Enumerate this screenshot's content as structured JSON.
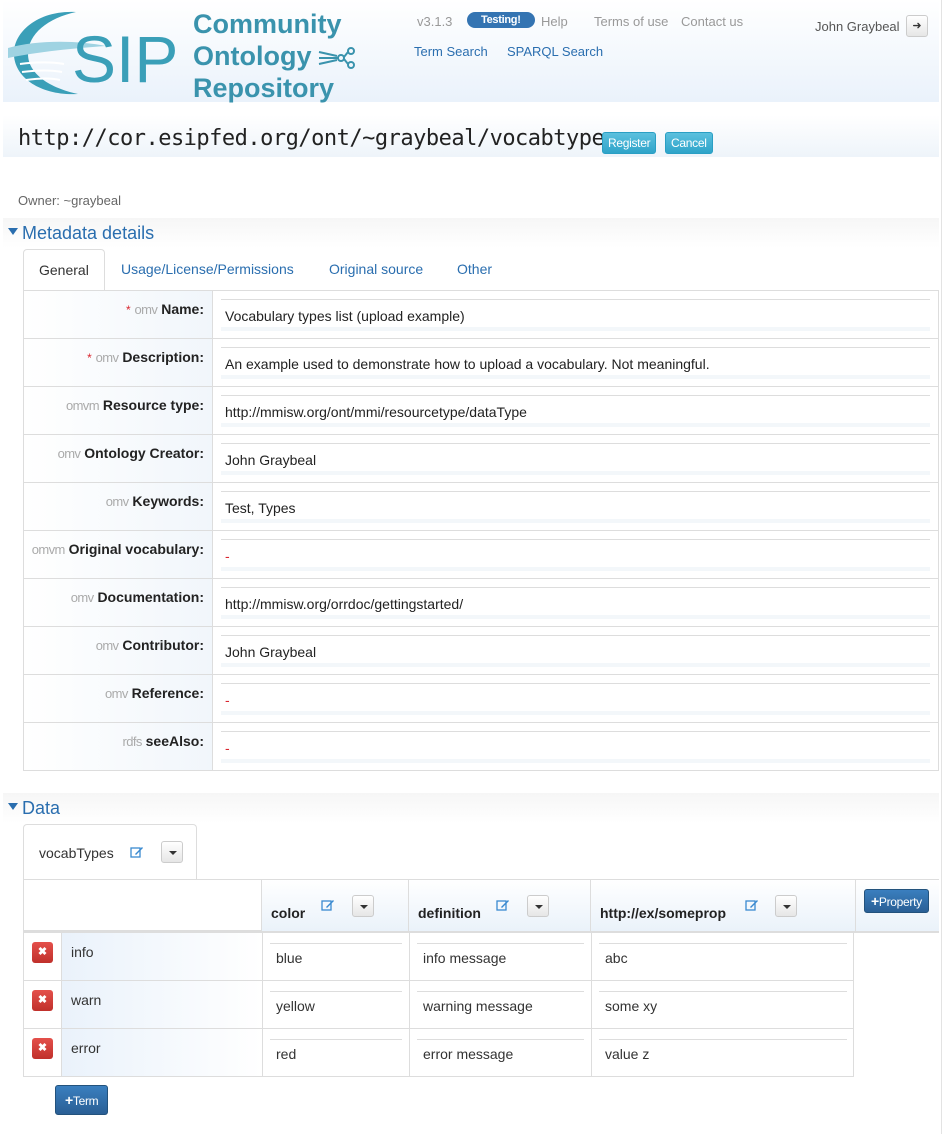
{
  "header": {
    "logo_letters": "SIP",
    "logo_lines": [
      "Community",
      "Ontology",
      "Repository"
    ],
    "version": "v3.1.3",
    "testing_badge": "Testing!",
    "help_link": "Help",
    "terms_link": "Terms of use",
    "contact_link": "Contact us",
    "term_search_link": "Term Search",
    "sparql_search_link": "SPARQL Search",
    "user_name": "John Graybeal",
    "logout_icon": "sign-out-icon"
  },
  "uri_bar": {
    "uri": "http://cor.esipfed.org/ont/~graybeal/vocabtypes",
    "register_label": "Register",
    "cancel_label": "Cancel"
  },
  "owner": "Owner: ~graybeal",
  "metadata": {
    "section_title": "Metadata details",
    "tabs": [
      {
        "label": "General",
        "active": true
      },
      {
        "label": "Usage/License/Permissions",
        "active": false
      },
      {
        "label": "Original source",
        "active": false
      },
      {
        "label": "Other",
        "active": false
      }
    ],
    "rows": [
      {
        "required": "*",
        "ns": "omv",
        "label": "Name:",
        "value": "Vocabulary types list (upload example)"
      },
      {
        "required": "*",
        "ns": "omv",
        "label": "Description:",
        "value": "An example used to demonstrate how to upload a vocabulary. Not meaningful."
      },
      {
        "required": "",
        "ns": "omvm",
        "label": "Resource type:",
        "value": "http://mmisw.org/ont/mmi/resourcetype/dataType"
      },
      {
        "required": "",
        "ns": "omv",
        "label": "Ontology Creator:",
        "value": "John Graybeal"
      },
      {
        "required": "",
        "ns": "omv",
        "label": "Keywords:",
        "value": "Test, Types"
      },
      {
        "required": "",
        "ns": "omvm",
        "label": "Original vocabulary:",
        "value": "-"
      },
      {
        "required": "",
        "ns": "omv",
        "label": "Documentation:",
        "value": "http://mmisw.org/orrdoc/gettingstarted/"
      },
      {
        "required": "",
        "ns": "omv",
        "label": "Contributor:",
        "value": "John Graybeal"
      },
      {
        "required": "",
        "ns": "omv",
        "label": "Reference:",
        "value": "-"
      },
      {
        "required": "",
        "ns": "rdfs",
        "label": "seeAlso:",
        "value": "-"
      }
    ]
  },
  "data": {
    "section_title": "Data",
    "class_tab": "vocabTypes",
    "columns": [
      "color",
      "definition",
      "http://ex/someprop"
    ],
    "add_property_label": "Property",
    "add_term_label": "Term",
    "rows": [
      {
        "term": "info",
        "values": [
          "blue",
          "info message",
          "abc"
        ]
      },
      {
        "term": "warn",
        "values": [
          "yellow",
          "warning message",
          "some xy"
        ]
      },
      {
        "term": "error",
        "values": [
          "red",
          "error message",
          "value z"
        ]
      }
    ]
  },
  "colors": {
    "brand": "#3a93ad",
    "link": "#2a6eaf",
    "info_button": "#5bc0de",
    "primary_button": "#2a5f95",
    "danger": "#d9262f"
  }
}
